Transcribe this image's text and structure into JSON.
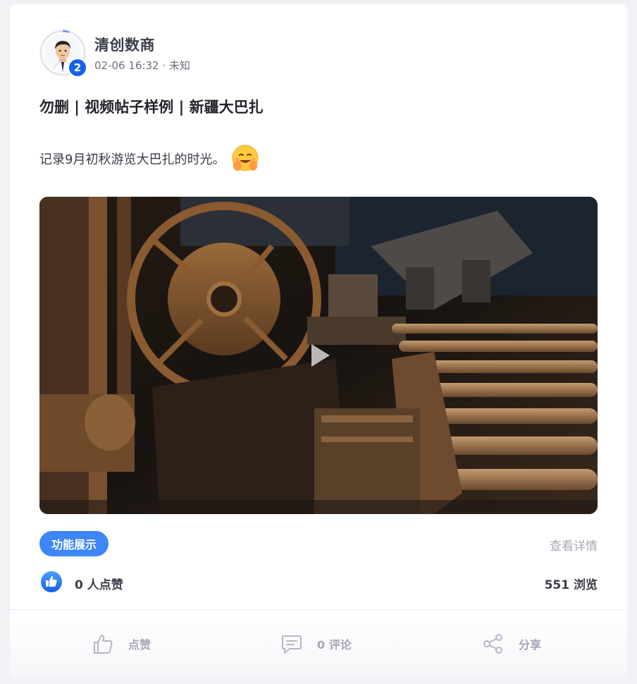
{
  "post": {
    "author": {
      "name": "清创数商",
      "level": "2"
    },
    "meta": "02-06 16:32 · 未知",
    "title": "勿删 | 视频帖子样例 | 新疆大巴扎",
    "body": "记录9月初秋游览大巴扎的时光。",
    "emoji": "hugging-face-emoji",
    "tag": "功能展示",
    "details_link": "查看详情",
    "likes_text": "0 人点赞",
    "views_text": "551 浏览"
  },
  "actions": {
    "like": "点赞",
    "comment": "0 评论",
    "share": "分享"
  },
  "colors": {
    "accent": "#3d86f6",
    "badge": "#1463e6",
    "muted": "#a5a7b8"
  }
}
